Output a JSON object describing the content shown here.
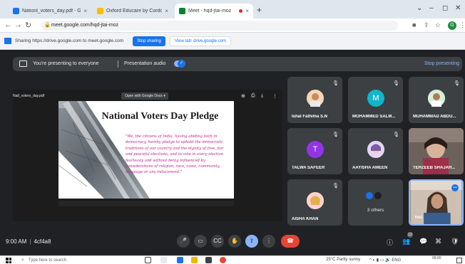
{
  "browser": {
    "tabs": [
      {
        "title": "Nationl_voters_day.pdf - Go",
        "favicon_color": "#1a73e8",
        "active": false
      },
      {
        "title": "Oxford Educare by Cordova Edu",
        "favicon_color": "#fbbc04",
        "active": false
      },
      {
        "title": "Meet - hqd-jtai-moz",
        "favicon_color": "#00832d",
        "active": true
      }
    ],
    "url": "meet.google.com/hqd-jtai-moz"
  },
  "sharebar": {
    "text": "Sharing https://drive.google.com to meet.google.com",
    "stop_label": "Stop sharing",
    "view_label": "View tab: drive.google.com"
  },
  "presenting_bar": {
    "text": "You're presenting to everyone",
    "audio_label": "Presentation audio",
    "stop_label": "Stop presenting"
  },
  "stage": {
    "file_name": "Natl_voters_day.pdf",
    "open_with": "Open with Google Docs",
    "slide_title": "National Voters Day Pledge",
    "slide_body": "\"We, the citizens of India, having abiding faith in democracy, hereby pledge to uphold the democratic traditions of our country and the dignity of free, fair and peaceful elections, and to vote in every election fearlessly and without being influenced by considerations of religion, race, caste, community, language or any inducement.\""
  },
  "participants": [
    {
      "name": "Ishal Fathima S.N",
      "avatar": "photo",
      "avatar_color": "#f28b82",
      "muted": true
    },
    {
      "name": "MOHAMMED SALM...",
      "avatar": "M",
      "avatar_color": "#12b5cb",
      "muted": true
    },
    {
      "name": "MUHAMMAD ABDU...",
      "avatar": "photo",
      "avatar_color": "#a8dab5",
      "muted": true
    },
    {
      "name": "TALWA SAFEER",
      "avatar": "T",
      "avatar_color": "#9334e6",
      "muted": true
    },
    {
      "name": "AAYISHA AMEEN",
      "avatar": "photo",
      "avatar_color": "#c7a0e8",
      "muted": true
    },
    {
      "name": "TEHZEEB SHAJAH...",
      "avatar": "video",
      "avatar_color": "#7a6a60",
      "muted": false
    },
    {
      "name": "AISHA KHAN",
      "avatar": "photo",
      "avatar_color": "#f6aea9",
      "muted": true
    },
    {
      "name": "3 others",
      "avatar": "group",
      "avatar_color": "#1e1e1e",
      "muted": false
    },
    {
      "name": "You",
      "avatar": "video",
      "avatar_color": "#b59a86",
      "muted": false
    }
  ],
  "bottom": {
    "time": "9:00 AM",
    "meeting_code": "4cf4a8",
    "people_count": "12"
  },
  "taskbar": {
    "search_placeholder": "Type here to search",
    "weather": "25°C  Partly sunny",
    "lang": "ENG",
    "time": "09:00"
  }
}
